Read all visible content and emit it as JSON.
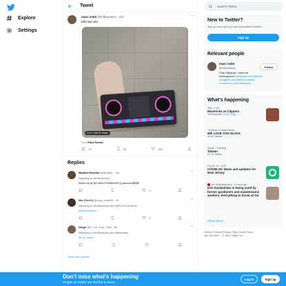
{
  "nav": {
    "explore": "Explore",
    "settings": "Settings"
  },
  "header": {
    "title": "Tweet"
  },
  "tweet": {
    "name": "marc eckō",
    "handle": "@Offparolers · 11h",
    "text": "Mfs last nite",
    "views": "0:19 / 426.7K views",
    "from_label": "From",
    "from_name": "Pablo Rochat",
    "replies": "7K",
    "retweets": "8K",
    "likes": "34K"
  },
  "replies_heading": "Replies",
  "replies": [
    {
      "name": "Maldito Rebelde",
      "handle": "@iks.ahl9 · 10h",
      "replying": "Replying to @Offparolers",
      "text": "Ahora mi dj @CARLOSNIÑOVM Q pasoooo😂😂",
      "r": "",
      "rt": "",
      "lk": "4"
    },
    {
      "name": "Nix {✢▸◂✢}",
      "handle": "@basu_babe95 · 9h",
      "replying": "Replying to @Offparolers and @FLEXXASmoor",
      "text": "@whoisfulzero",
      "r": "",
      "rt": "",
      "lk": "2"
    },
    {
      "name": "Diego",
      "handle": "@O_On_Your_Face · 8h",
      "replying": "Replying to @Offparolers and @tischldiy",
      "text": "@_su_Melk",
      "r": "",
      "rt": "",
      "lk": ""
    }
  ],
  "more_replies": "View more replies",
  "search": {
    "placeholder": "Search Twitter"
  },
  "new_to_twitter": {
    "title": "New to Twitter?",
    "sub": "Sign up now to get your own personalized timeline!",
    "button": "Sign up"
  },
  "relevant": {
    "title": "Relevant people",
    "name": "marc eckō",
    "handle": "@Offparolers",
    "follow": "Follow",
    "bio1": "Club Offparole / meet me",
    "bio2": "underground",
    "link1": "instagram.com/offparole",
    "link2": "instagram.com/meetmeunderg",
    "link3": "soundcloud.com/offparolers"
  },
  "happening": {
    "title": "What's happening",
    "trends": [
      {
        "cat": "NBA · LIVE",
        "name": "Mavericks at Clippers",
        "count": "Trending with Torrey Craig"
      },
      {
        "cat": "Trending in United States",
        "name": "WE LOVE YOU OLIVIA",
        "count": "35.5K Tweets"
      },
      {
        "cat": "Sports · Trending",
        "name": "Taiwan",
        "count": "92.7K Tweets"
      },
      {
        "cat": "COVID-19 · LIVE",
        "name": "COVID-19: News and updates for New Jersey",
        "count": ""
      },
      {
        "cat": "LAT Entertainement · 5 hours ago",
        "name": "Kim Kardashian is being sued by former gardeners and maintenance workers. Everything to know so far",
        "count": ""
      }
    ],
    "show_more": "Show more"
  },
  "footer": {
    "l1": "Terms of Service   Privacy Policy   Cookie Policy",
    "l2": "Ads info   More ···   © 2021 Twitter, Inc."
  },
  "banner": {
    "title": "Don't miss what's happening",
    "sub": "People on Twitter are the first to know.",
    "login": "Log in",
    "signup": "Sign up"
  },
  "colors": {
    "accent": "#1d9bf0",
    "text": "#0f1419",
    "muted": "#536471"
  }
}
